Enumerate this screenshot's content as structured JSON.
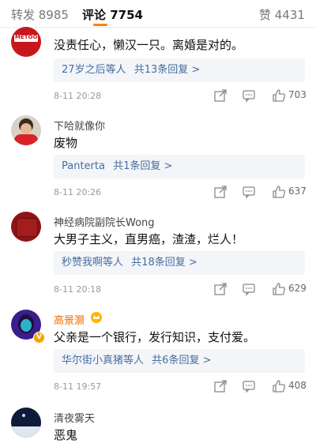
{
  "tabs": {
    "reposts": "转发 8985",
    "comments": "评论 7754",
    "likes": "赞 4431"
  },
  "comments": [
    {
      "username": "",
      "avatar_text": "METOO",
      "text": "没责任心，懒汉一只。离婚是对的。",
      "reply": {
        "prefix": "27岁之后",
        "suffix": "等人",
        "count": "共13条回复 >"
      },
      "time": "8-11 20:28",
      "likes": "703"
    },
    {
      "username": "下哈就像你",
      "text": "废物",
      "reply": {
        "prefix": "Panterta",
        "suffix": "",
        "count": "共1条回复 >"
      },
      "time": "8-11 20:26",
      "likes": "637"
    },
    {
      "username": "神经病院副院长Wong",
      "text": "大男子主义，直男癌，渣渣，烂人！",
      "reply": {
        "prefix": "秒赞我啊",
        "suffix": "等人",
        "count": "共18条回复 >"
      },
      "time": "8-11 20:18",
      "likes": "629"
    },
    {
      "username": "高景灏",
      "text": "父亲是一个银行，发行知识，支付爱。",
      "reply": {
        "prefix": "华尔街小真猪",
        "suffix": "等人",
        "count": "共6条回复 >"
      },
      "time": "8-11 19:57",
      "likes": "408",
      "verified_badge": "V"
    },
    {
      "username": "清夜雾天",
      "text": "恶鬼"
    }
  ],
  "colors": {
    "accent": "#ff8200",
    "link": "#456e9e",
    "reply_bg": "#f3f5f9"
  }
}
